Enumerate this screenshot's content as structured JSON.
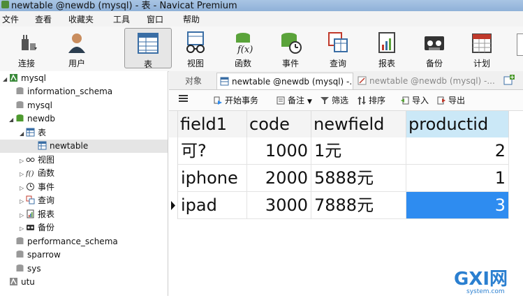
{
  "window": {
    "title": "newtable @newdb (mysql) - 表 - Navicat Premium"
  },
  "menu": [
    "文件",
    "查看",
    "收藏夹",
    "工具",
    "窗口",
    "帮助"
  ],
  "toolbar": {
    "items": [
      {
        "label": "连接",
        "icon": "plug-icon"
      },
      {
        "label": "用户",
        "icon": "user-icon"
      },
      {
        "label": "表",
        "icon": "table-icon",
        "active": true
      },
      {
        "label": "视图",
        "icon": "glasses-icon"
      },
      {
        "label": "函数",
        "icon": "function-icon"
      },
      {
        "label": "事件",
        "icon": "clock-db-icon"
      },
      {
        "label": "查询",
        "icon": "query-icon"
      },
      {
        "label": "报表",
        "icon": "report-icon"
      },
      {
        "label": "备份",
        "icon": "tape-icon"
      },
      {
        "label": "计划",
        "icon": "calendar-icon"
      }
    ]
  },
  "tree": {
    "items": [
      {
        "label": "mysql",
        "icon": "connection-icon",
        "expander": "◢",
        "level": 0
      },
      {
        "label": "information_schema",
        "icon": "database-icon",
        "level": 1
      },
      {
        "label": "mysql",
        "icon": "database-icon",
        "level": 1
      },
      {
        "label": "newdb",
        "icon": "database-icon",
        "expander": "◢",
        "level": 1
      },
      {
        "label": "表",
        "icon": "table-icon",
        "expander": "◢",
        "level": 2
      },
      {
        "label": "newtable",
        "icon": "table-icon",
        "level": 3,
        "selected": true
      },
      {
        "label": "视图",
        "icon": "glasses-icon",
        "expander": "▷",
        "level": 2
      },
      {
        "label": "函数",
        "icon": "function-icon",
        "expander": "▷",
        "level": 2
      },
      {
        "label": "事件",
        "icon": "clock-icon",
        "expander": "▷",
        "level": 2
      },
      {
        "label": "查询",
        "icon": "query-icon",
        "expander": "▷",
        "level": 2
      },
      {
        "label": "报表",
        "icon": "report-icon",
        "expander": "▷",
        "level": 2
      },
      {
        "label": "备份",
        "icon": "tape-icon",
        "expander": "▷",
        "level": 2
      },
      {
        "label": "performance_schema",
        "icon": "database-icon",
        "level": 1
      },
      {
        "label": "sparrow",
        "icon": "database-icon",
        "level": 1
      },
      {
        "label": "sys",
        "icon": "database-icon",
        "level": 1
      },
      {
        "label": "utu",
        "icon": "connection-icon",
        "level": 0
      }
    ]
  },
  "tabs": [
    {
      "label": "对象"
    },
    {
      "label": "newtable @newdb (mysql) -..."
    },
    {
      "label": "newtable @newdb (mysql) -..."
    }
  ],
  "subtoolbar": {
    "items": [
      {
        "label": "",
        "icon": "hamburger-icon"
      },
      {
        "label": "开始事务",
        "icon": "transaction-icon"
      },
      {
        "label": "备注",
        "icon": "note-icon"
      },
      {
        "label": "筛选",
        "icon": "filter-icon"
      },
      {
        "label": "排序",
        "icon": "sort-icon"
      },
      {
        "label": "导入",
        "icon": "import-icon"
      },
      {
        "label": "导出",
        "icon": "export-icon"
      }
    ]
  },
  "grid": {
    "columns": [
      "field1",
      "code",
      "newfield",
      "productid"
    ],
    "rows": [
      [
        "可?",
        "1000",
        "1元",
        "2"
      ],
      [
        "iphone",
        "2000",
        "5888元",
        "1"
      ],
      [
        "ipad",
        "3000",
        "7888元",
        "3"
      ]
    ]
  },
  "watermark": {
    "text": "GXI网",
    "subtext": "system.com"
  },
  "colors": {
    "selection": "#2e8cf0",
    "header_selected": "#cbe8f7"
  }
}
